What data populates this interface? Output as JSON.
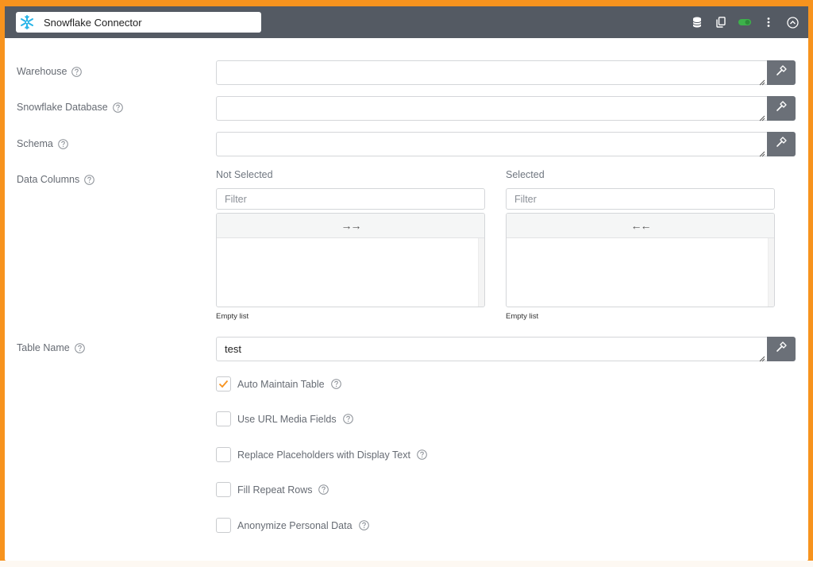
{
  "header": {
    "title": "Snowflake Connector",
    "icons": [
      "database-icon",
      "copy-icon",
      "toggle-icon",
      "more-icon",
      "collapse-icon"
    ],
    "toggle_on": true,
    "accent": "#f7931e",
    "logo_color": "#29b5e8",
    "toggle_color": "#3cb24a"
  },
  "fields": {
    "warehouse": {
      "label": "Warehouse",
      "value": ""
    },
    "database": {
      "label": "Snowflake Database",
      "value": ""
    },
    "schema": {
      "label": "Schema",
      "value": ""
    },
    "table_name": {
      "label": "Table Name",
      "value": "test"
    }
  },
  "data_columns": {
    "label": "Data Columns",
    "not_selected": {
      "title": "Not Selected",
      "filter_placeholder": "Filter",
      "move_label": "→→",
      "empty_text": "Empty list"
    },
    "selected": {
      "title": "Selected",
      "filter_placeholder": "Filter",
      "move_label": "←←",
      "empty_text": "Empty list"
    }
  },
  "options": [
    {
      "label": "Auto Maintain Table",
      "checked": true
    },
    {
      "label": "Use URL Media Fields",
      "checked": false
    },
    {
      "label": "Replace Placeholders with Display Text",
      "checked": false
    },
    {
      "label": "Fill Repeat Rows",
      "checked": false
    },
    {
      "label": "Anonymize Personal Data",
      "checked": false
    }
  ]
}
